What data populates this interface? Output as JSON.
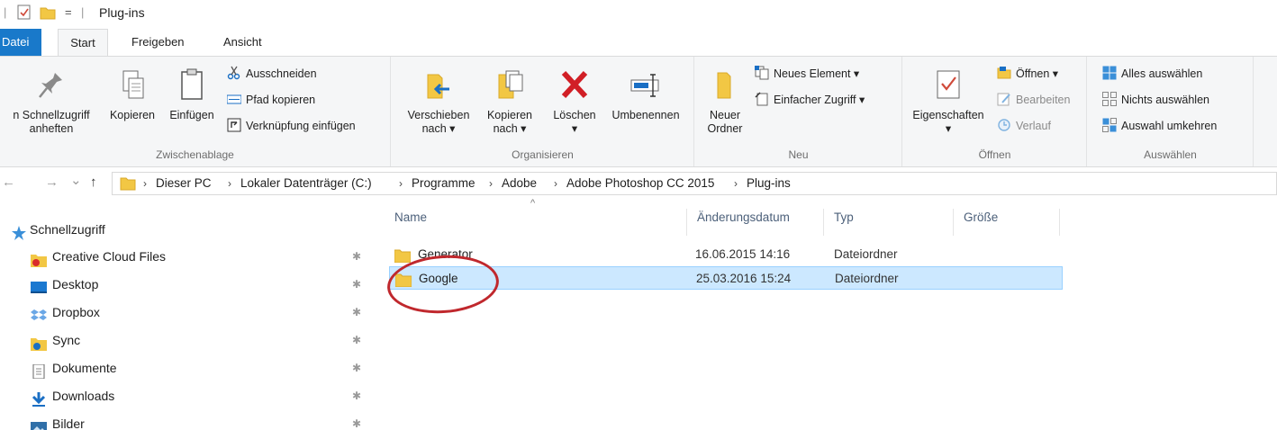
{
  "window": {
    "title": "Plug-ins",
    "quick_access_separator": "|",
    "quick_access_dropdown": "="
  },
  "tabs": [
    {
      "label": "Datei"
    },
    {
      "label": "Start"
    },
    {
      "label": "Freigeben"
    },
    {
      "label": "Ansicht"
    }
  ],
  "ribbon": {
    "clipboard": {
      "label": "Zwischenablage",
      "pin_line1": "n Schnellzugriff",
      "pin_line2": "anheften",
      "copy": "Kopieren",
      "paste": "Einfügen",
      "cut": "Ausschneiden",
      "copy_path": "Pfad kopieren",
      "paste_shortcut": "Verknüpfung einfügen"
    },
    "organize": {
      "label": "Organisieren",
      "move_line1": "Verschieben",
      "move_line2": "nach ▾",
      "copy_line1": "Kopieren",
      "copy_line2": "nach ▾",
      "delete_line1": "Löschen",
      "delete_line2": "▾",
      "rename": "Umbenennen"
    },
    "new": {
      "label": "Neu",
      "folder_line1": "Neuer",
      "folder_line2": "Ordner",
      "new_item": "Neues Element ▾",
      "easy_access": "Einfacher Zugriff ▾"
    },
    "open": {
      "label": "Öffnen",
      "properties_line1": "Eigenschaften",
      "properties_line2": "▾",
      "open": "Öffnen ▾",
      "edit": "Bearbeiten",
      "history": "Verlauf"
    },
    "select": {
      "label": "Auswählen",
      "select_all": "Alles auswählen",
      "select_none": "Nichts auswählen",
      "invert": "Auswahl umkehren"
    }
  },
  "address": {
    "back": "←",
    "forward": "→",
    "recent": "⌄",
    "up": "↑",
    "crumbs": [
      "Dieser PC",
      "Lokaler Datenträger (C:)",
      "Programme",
      "Adobe",
      "Adobe Photoshop CC 2015",
      "Plug-ins"
    ],
    "separator": "›"
  },
  "navigation": {
    "header": "Schnellzugriff",
    "pin_glyph": "✱",
    "items": [
      {
        "label": "Creative Cloud Files"
      },
      {
        "label": "Desktop"
      },
      {
        "label": "Dropbox"
      },
      {
        "label": "Sync"
      },
      {
        "label": "Dokumente"
      },
      {
        "label": "Downloads"
      },
      {
        "label": "Bilder"
      }
    ]
  },
  "filelist": {
    "sort_indicator": "^",
    "columns": {
      "name": "Name",
      "date": "Änderungsdatum",
      "type": "Typ",
      "size": "Größe"
    },
    "rows": [
      {
        "name": "Generator",
        "date": "16.06.2015 14:16",
        "type": "Dateiordner",
        "selected": false
      },
      {
        "name": "Google",
        "date": "25.03.2016 15:24",
        "type": "Dateiordner",
        "selected": true
      }
    ]
  },
  "colors": {
    "file_tab": "#1979ca",
    "selection": "#cce8ff",
    "selection_border": "#99d1ff",
    "annotation_circle": "#c0282d",
    "folder": "#f2c744"
  }
}
